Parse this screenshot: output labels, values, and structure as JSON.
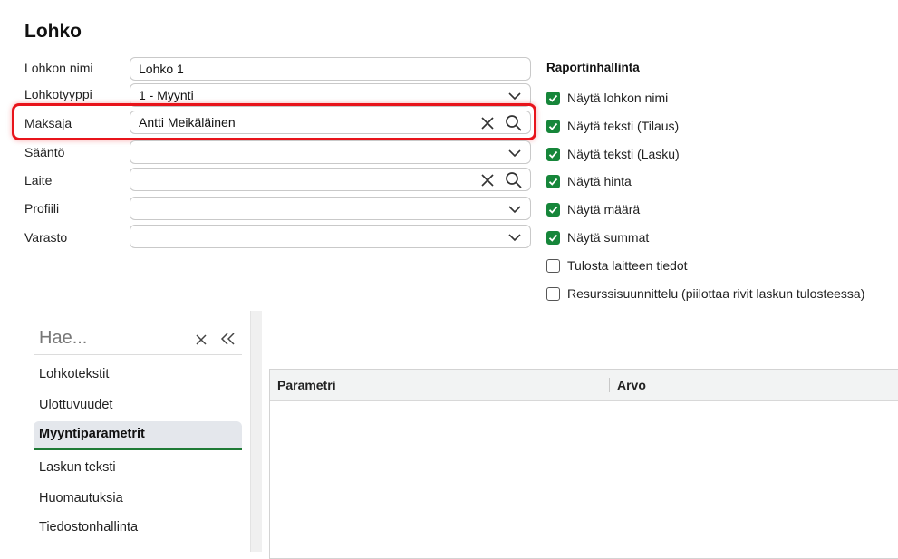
{
  "title": "Lohko",
  "form": {
    "block_name_label": "Lohkon nimi",
    "block_name_value": "Lohko 1",
    "block_type_label": "Lohkotyyppi",
    "block_type_value": "1 - Myynti",
    "payer_label": "Maksaja",
    "payer_value": "Antti Meikäläinen",
    "rule_label": "Sääntö",
    "device_label": "Laite",
    "profile_label": "Profiili",
    "warehouse_label": "Varasto"
  },
  "report": {
    "title": "Raportinhallinta",
    "options": [
      {
        "label": "Näytä lohkon nimi",
        "checked": true
      },
      {
        "label": "Näytä teksti (Tilaus)",
        "checked": true
      },
      {
        "label": "Näytä teksti (Lasku)",
        "checked": true
      },
      {
        "label": "Näytä hinta",
        "checked": true
      },
      {
        "label": "Näytä määrä",
        "checked": true
      },
      {
        "label": "Näytä summat",
        "checked": true
      },
      {
        "label": "Tulosta laitteen tiedot",
        "checked": false
      },
      {
        "label": "Resurssisuunnittelu (piilottaa rivit laskun tulosteessa)",
        "checked": false
      }
    ]
  },
  "sidebar": {
    "search_placeholder": "Hae...",
    "items": [
      {
        "label": "Lohkotekstit"
      },
      {
        "label": "Ulottuvuudet"
      },
      {
        "label": "Myyntiparametrit",
        "active": true
      },
      {
        "label": "Laskun teksti"
      },
      {
        "label": "Huomautuksia"
      },
      {
        "label": "Tiedostonhallinta"
      }
    ]
  },
  "grid": {
    "columns": [
      "Parametri",
      "Arvo"
    ]
  },
  "colors": {
    "accent": "#16863a",
    "highlight": "#e8141b"
  }
}
